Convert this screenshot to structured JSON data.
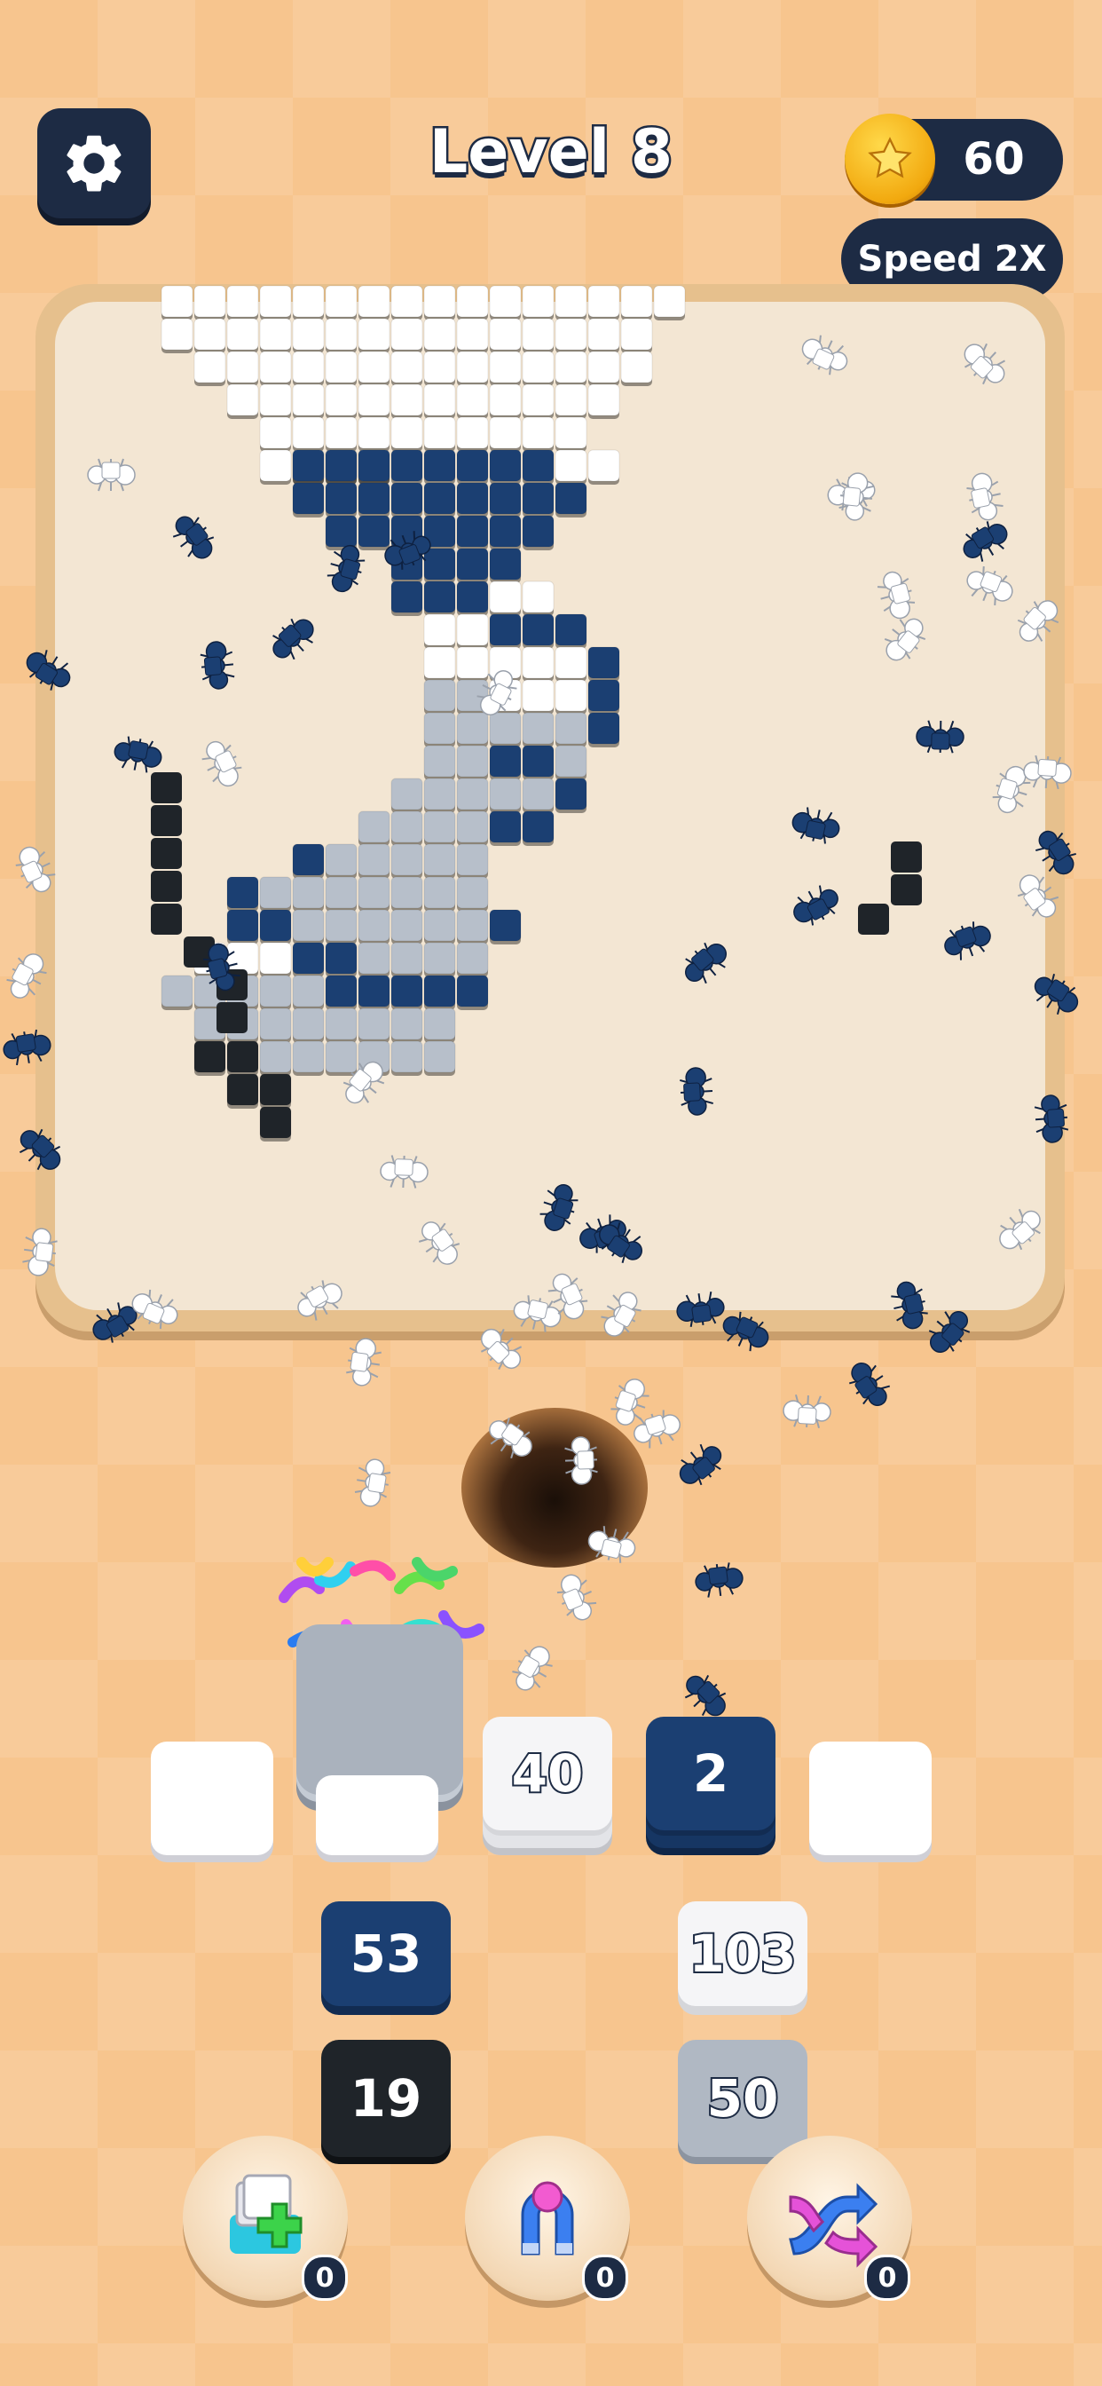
{
  "header": {
    "level_label": "Level 8",
    "coins": "60",
    "speed_label": "Speed 2X"
  },
  "colors": {
    "navy": "#1b3f72",
    "white": "#ffffff",
    "grey": "#b7bfca",
    "black": "#1f2429",
    "panel": "#1d2b44"
  },
  "slots": {
    "rows": [
      [
        {
          "type": "empty"
        },
        {
          "type": "stack",
          "color": "grey",
          "label": ""
        },
        {
          "type": "stack",
          "color": "white",
          "label": "40"
        },
        {
          "type": "stack",
          "color": "navy",
          "label": "2"
        },
        {
          "type": "empty"
        }
      ]
    ]
  },
  "queue": {
    "left_column": [
      {
        "color": "navy",
        "label": "53"
      },
      {
        "color": "black",
        "label": "19"
      }
    ],
    "right_column": [
      {
        "color": "white",
        "label": "103"
      },
      {
        "color": "grey",
        "label": "50"
      }
    ]
  },
  "powerups": [
    {
      "name": "add-slot-powerup",
      "icon": "add-slot-icon",
      "count": "0"
    },
    {
      "name": "magnet-powerup",
      "icon": "magnet-icon",
      "count": "0"
    },
    {
      "name": "shuffle-powerup",
      "icon": "shuffle-icon",
      "count": "0"
    }
  ]
}
